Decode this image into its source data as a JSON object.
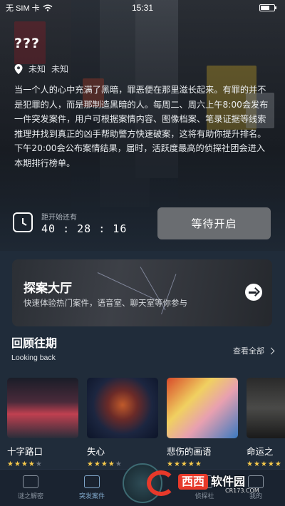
{
  "status_bar": {
    "carrier": "无 SIM 卡",
    "time": "15:31"
  },
  "case": {
    "title": "???",
    "location_city": "未知",
    "location_place": "未知",
    "description": "当一个人的心中充满了黑暗，罪恶便在那里滋长起来。有罪的并不是犯罪的人，而是那制造黑暗的人。每周二、周六上午8:00会发布一件突发案件，用户可根据案情内容、图像档案、笔录证据等线索推理并找到真正的凶手帮助警方快速破案，这将有助你提升排名。下午20:00会公布案情结果，届时，活跃度最高的侦探社团会进入本期排行榜单。",
    "countdown_label": "距开始还有",
    "countdown": "40 : 28 : 16",
    "wait_button": "等待开启"
  },
  "hall": {
    "title": "探案大厅",
    "subtitle": "快速体验热门案件，语音室、聊天室等你参与"
  },
  "review": {
    "title": "回顾往期",
    "subtitle": "Looking back",
    "view_all": "查看全部",
    "cards": [
      {
        "name": "十字路口",
        "rating": 4
      },
      {
        "name": "失心",
        "rating": 4
      },
      {
        "name": "悲伤的画语",
        "rating": 5
      },
      {
        "name": "命运之",
        "rating": 5
      }
    ]
  },
  "tabbar": {
    "tabs": [
      {
        "label": "谜之解密"
      },
      {
        "label": "突发案件"
      },
      {
        "label": "侦探社"
      },
      {
        "label": "我的"
      }
    ]
  },
  "watermark": {
    "brand": "西西",
    "name": "软件园",
    "url": "CR173.COM"
  },
  "colors": {
    "background": "#202c3a",
    "star": "#f6c94b",
    "button": "#6a6d71",
    "active_tab": "#7fa6c8",
    "watermark_red": "#e7392a"
  }
}
